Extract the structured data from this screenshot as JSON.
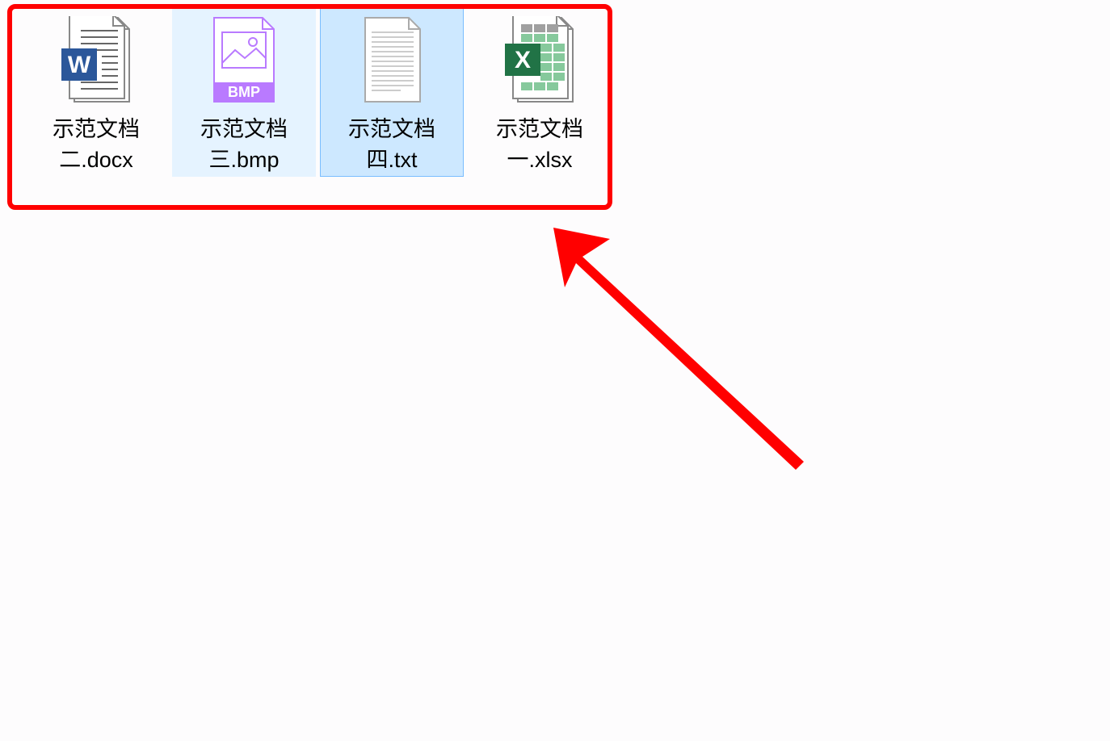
{
  "files": [
    {
      "name_line1": "示范文档",
      "name_line2": "二.docx",
      "type": "docx",
      "state": "normal"
    },
    {
      "name_line1": "示范文档",
      "name_line2": "三.bmp",
      "type": "bmp",
      "state": "hover"
    },
    {
      "name_line1": "示范文档",
      "name_line2": "四.txt",
      "type": "txt",
      "state": "selected"
    },
    {
      "name_line1": "示范文档",
      "name_line2": "一.xlsx",
      "type": "xlsx",
      "state": "normal"
    }
  ],
  "bmp_badge": "BMP",
  "colors": {
    "highlight_border": "#ff0000",
    "arrow": "#ff0000",
    "word": "#2b579a",
    "excel": "#217346",
    "bmp": "#b97aff"
  }
}
